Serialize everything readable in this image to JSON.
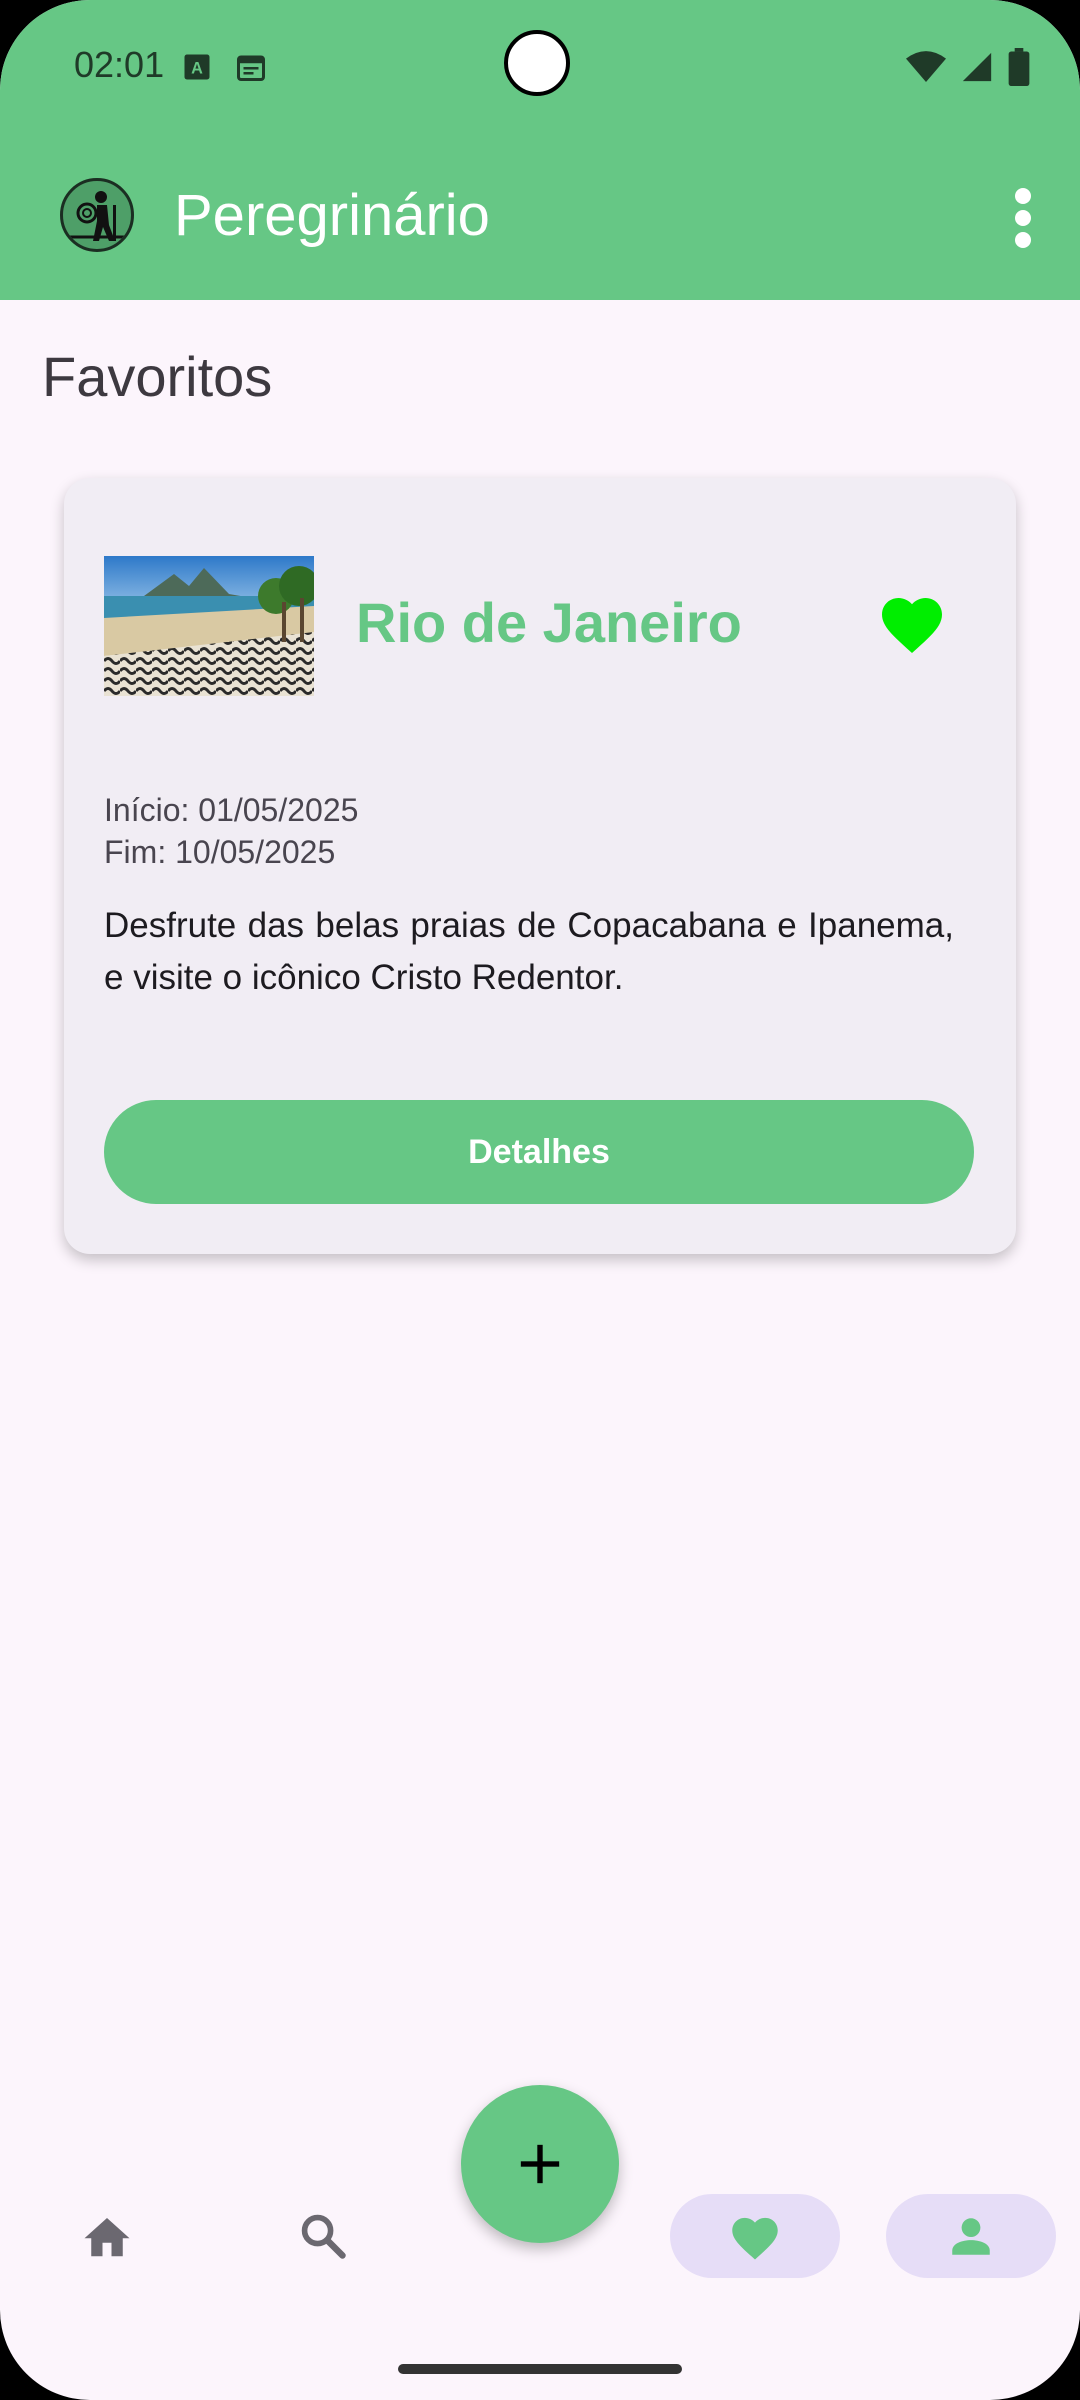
{
  "status_bar": {
    "time": "02:01",
    "notification_icons": [
      "font-download-icon",
      "calendar-icon"
    ],
    "system_icons": [
      "wifi-icon",
      "cell-signal-icon",
      "battery-icon"
    ]
  },
  "app_bar": {
    "title": "Peregrinário",
    "logo_icon": "hiker-logo-icon",
    "menu_icon": "more-vert-icon"
  },
  "section": {
    "title": "Favoritos"
  },
  "card": {
    "image": "beach-photo",
    "destination": "Rio de Janeiro",
    "start_date": "Início: 01/05/2025",
    "end_date": "Fim: 10/05/2025",
    "description": "Desfrute das belas praias de Copacabana e Ipanema, e visite o icônico Cristo Redentor.",
    "favorited": true,
    "button_label": "Detalhes"
  },
  "fab": {
    "icon": "plus-icon"
  },
  "bottom_nav": {
    "items": [
      {
        "icon": "home-icon",
        "selected": false
      },
      {
        "icon": "search-icon",
        "selected": false
      },
      {
        "icon": "heart-icon",
        "selected": true
      },
      {
        "icon": "person-icon",
        "selected": true
      }
    ]
  },
  "colors": {
    "primary_green": "#66c785",
    "heart_green": "#00ee00",
    "background": "#fcf5fc",
    "card_bg": "#f1edf4",
    "nav_pill": "#e6ddf7",
    "nav_icon": "#6b6870"
  }
}
